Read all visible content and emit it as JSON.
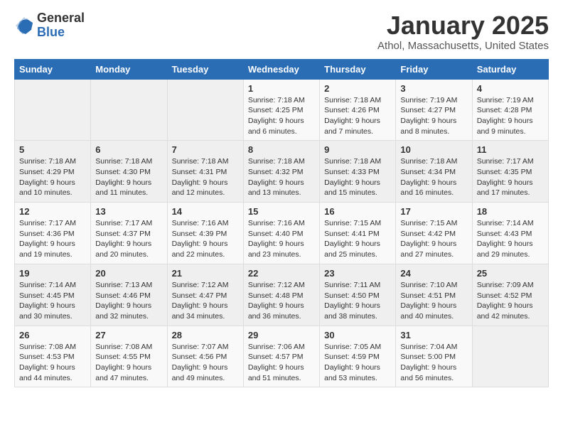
{
  "logo": {
    "general": "General",
    "blue": "Blue"
  },
  "header": {
    "title": "January 2025",
    "subtitle": "Athol, Massachusetts, United States"
  },
  "weekdays": [
    "Sunday",
    "Monday",
    "Tuesday",
    "Wednesday",
    "Thursday",
    "Friday",
    "Saturday"
  ],
  "weeks": [
    [
      {
        "day": "",
        "info": ""
      },
      {
        "day": "",
        "info": ""
      },
      {
        "day": "",
        "info": ""
      },
      {
        "day": "1",
        "info": "Sunrise: 7:18 AM\nSunset: 4:25 PM\nDaylight: 9 hours and 6 minutes."
      },
      {
        "day": "2",
        "info": "Sunrise: 7:18 AM\nSunset: 4:26 PM\nDaylight: 9 hours and 7 minutes."
      },
      {
        "day": "3",
        "info": "Sunrise: 7:19 AM\nSunset: 4:27 PM\nDaylight: 9 hours and 8 minutes."
      },
      {
        "day": "4",
        "info": "Sunrise: 7:19 AM\nSunset: 4:28 PM\nDaylight: 9 hours and 9 minutes."
      }
    ],
    [
      {
        "day": "5",
        "info": "Sunrise: 7:18 AM\nSunset: 4:29 PM\nDaylight: 9 hours and 10 minutes."
      },
      {
        "day": "6",
        "info": "Sunrise: 7:18 AM\nSunset: 4:30 PM\nDaylight: 9 hours and 11 minutes."
      },
      {
        "day": "7",
        "info": "Sunrise: 7:18 AM\nSunset: 4:31 PM\nDaylight: 9 hours and 12 minutes."
      },
      {
        "day": "8",
        "info": "Sunrise: 7:18 AM\nSunset: 4:32 PM\nDaylight: 9 hours and 13 minutes."
      },
      {
        "day": "9",
        "info": "Sunrise: 7:18 AM\nSunset: 4:33 PM\nDaylight: 9 hours and 15 minutes."
      },
      {
        "day": "10",
        "info": "Sunrise: 7:18 AM\nSunset: 4:34 PM\nDaylight: 9 hours and 16 minutes."
      },
      {
        "day": "11",
        "info": "Sunrise: 7:17 AM\nSunset: 4:35 PM\nDaylight: 9 hours and 17 minutes."
      }
    ],
    [
      {
        "day": "12",
        "info": "Sunrise: 7:17 AM\nSunset: 4:36 PM\nDaylight: 9 hours and 19 minutes."
      },
      {
        "day": "13",
        "info": "Sunrise: 7:17 AM\nSunset: 4:37 PM\nDaylight: 9 hours and 20 minutes."
      },
      {
        "day": "14",
        "info": "Sunrise: 7:16 AM\nSunset: 4:39 PM\nDaylight: 9 hours and 22 minutes."
      },
      {
        "day": "15",
        "info": "Sunrise: 7:16 AM\nSunset: 4:40 PM\nDaylight: 9 hours and 23 minutes."
      },
      {
        "day": "16",
        "info": "Sunrise: 7:15 AM\nSunset: 4:41 PM\nDaylight: 9 hours and 25 minutes."
      },
      {
        "day": "17",
        "info": "Sunrise: 7:15 AM\nSunset: 4:42 PM\nDaylight: 9 hours and 27 minutes."
      },
      {
        "day": "18",
        "info": "Sunrise: 7:14 AM\nSunset: 4:43 PM\nDaylight: 9 hours and 29 minutes."
      }
    ],
    [
      {
        "day": "19",
        "info": "Sunrise: 7:14 AM\nSunset: 4:45 PM\nDaylight: 9 hours and 30 minutes."
      },
      {
        "day": "20",
        "info": "Sunrise: 7:13 AM\nSunset: 4:46 PM\nDaylight: 9 hours and 32 minutes."
      },
      {
        "day": "21",
        "info": "Sunrise: 7:12 AM\nSunset: 4:47 PM\nDaylight: 9 hours and 34 minutes."
      },
      {
        "day": "22",
        "info": "Sunrise: 7:12 AM\nSunset: 4:48 PM\nDaylight: 9 hours and 36 minutes."
      },
      {
        "day": "23",
        "info": "Sunrise: 7:11 AM\nSunset: 4:50 PM\nDaylight: 9 hours and 38 minutes."
      },
      {
        "day": "24",
        "info": "Sunrise: 7:10 AM\nSunset: 4:51 PM\nDaylight: 9 hours and 40 minutes."
      },
      {
        "day": "25",
        "info": "Sunrise: 7:09 AM\nSunset: 4:52 PM\nDaylight: 9 hours and 42 minutes."
      }
    ],
    [
      {
        "day": "26",
        "info": "Sunrise: 7:08 AM\nSunset: 4:53 PM\nDaylight: 9 hours and 44 minutes."
      },
      {
        "day": "27",
        "info": "Sunrise: 7:08 AM\nSunset: 4:55 PM\nDaylight: 9 hours and 47 minutes."
      },
      {
        "day": "28",
        "info": "Sunrise: 7:07 AM\nSunset: 4:56 PM\nDaylight: 9 hours and 49 minutes."
      },
      {
        "day": "29",
        "info": "Sunrise: 7:06 AM\nSunset: 4:57 PM\nDaylight: 9 hours and 51 minutes."
      },
      {
        "day": "30",
        "info": "Sunrise: 7:05 AM\nSunset: 4:59 PM\nDaylight: 9 hours and 53 minutes."
      },
      {
        "day": "31",
        "info": "Sunrise: 7:04 AM\nSunset: 5:00 PM\nDaylight: 9 hours and 56 minutes."
      },
      {
        "day": "",
        "info": ""
      }
    ]
  ]
}
